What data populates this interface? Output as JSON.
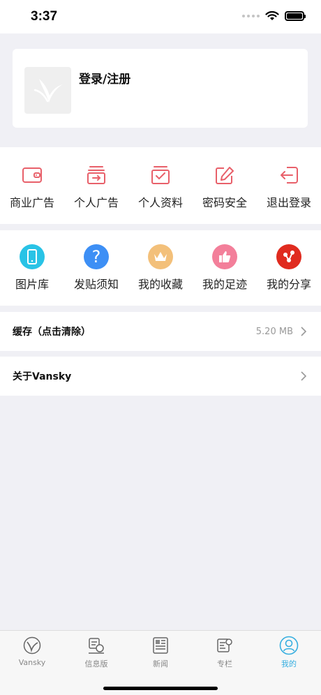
{
  "status": {
    "time": "3:37"
  },
  "profile": {
    "login_label": "登录/注册"
  },
  "account_menu": [
    {
      "label": "商业广告",
      "icon": "wallet-icon"
    },
    {
      "label": "个人广告",
      "icon": "box-arrow-icon"
    },
    {
      "label": "个人资料",
      "icon": "box-check-icon"
    },
    {
      "label": "密码安全",
      "icon": "pencil-icon"
    },
    {
      "label": "退出登录",
      "icon": "logout-icon"
    }
  ],
  "feature_menu": [
    {
      "label": "图片库",
      "icon": "phone-icon",
      "color": "#29c3e6"
    },
    {
      "label": "发贴须知",
      "icon": "question-icon",
      "color": "#3d8ff5"
    },
    {
      "label": "我的收藏",
      "icon": "crown-icon",
      "color": "#f3c07a"
    },
    {
      "label": "我的足迹",
      "icon": "thumbs-up-icon",
      "color": "#f37f9a"
    },
    {
      "label": "我的分享",
      "icon": "share-icon",
      "color": "#e02b1f"
    }
  ],
  "cache": {
    "title": "缓存（点击清除）",
    "value": "5.20 MB"
  },
  "about": {
    "title": "关于Vansky"
  },
  "tabs": [
    {
      "label": "Vansky",
      "icon": "vansky-logo-icon",
      "active": false
    },
    {
      "label": "信息版",
      "icon": "info-board-icon",
      "active": false
    },
    {
      "label": "新闻",
      "icon": "newspaper-icon",
      "active": false
    },
    {
      "label": "专栏",
      "icon": "column-icon",
      "active": false
    },
    {
      "label": "我的",
      "icon": "profile-icon",
      "active": true
    }
  ],
  "colors": {
    "accent": "#35aee0",
    "line_icon": "#e8606a",
    "background": "#f0f0f5"
  }
}
